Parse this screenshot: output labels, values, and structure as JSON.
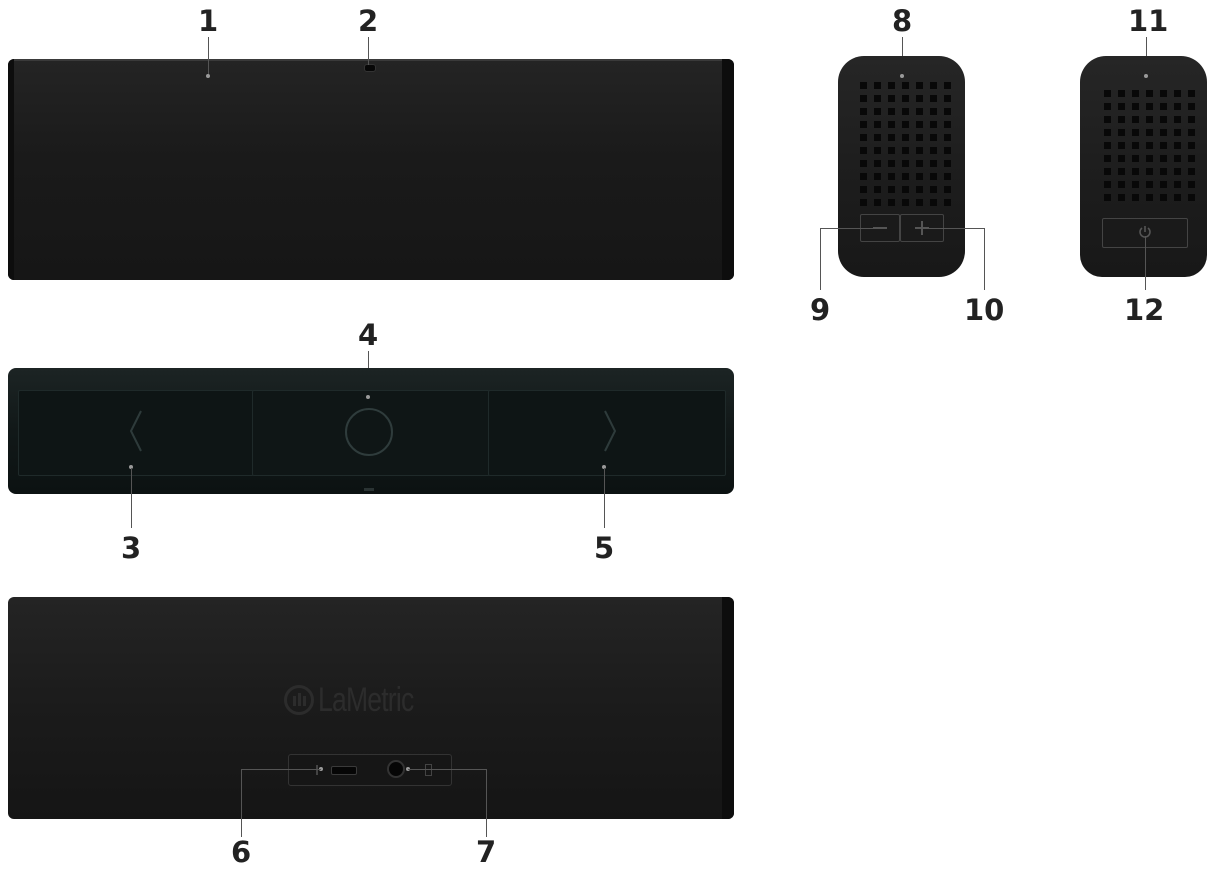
{
  "callouts": {
    "n1": "1",
    "n2": "2",
    "n3": "3",
    "n4": "4",
    "n5": "5",
    "n6": "6",
    "n7": "7",
    "n8": "8",
    "n9": "9",
    "n10": "10",
    "n11": "11",
    "n12": "12"
  },
  "brand": {
    "logo_text": "LaMetric"
  },
  "colors": {
    "device_body": "#1b1b1b",
    "device_front": "#0f1616",
    "leader_line": "#555555",
    "background": "#ffffff"
  }
}
